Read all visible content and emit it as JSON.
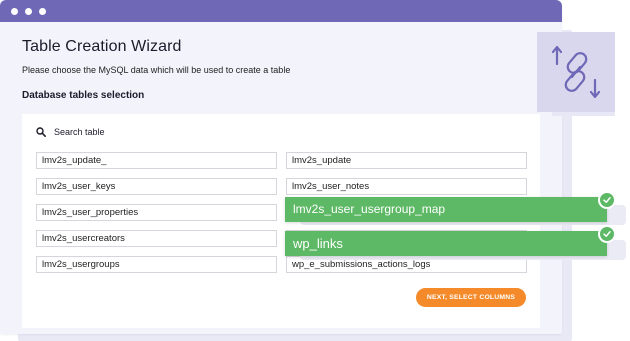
{
  "window": {
    "titlebar_color": "#6f68b6"
  },
  "wizard": {
    "title": "Table Creation Wizard",
    "description": "Please choose the MySQL data which will be used to create a table",
    "section_title": "Database tables selection",
    "search": {
      "label": "Search table",
      "icon": "search-icon"
    },
    "tables_left": [
      "lmv2s_update_",
      "lmv2s_user_keys",
      "lmv2s_user_properties",
      "lmv2s_usercreators",
      "lmv2s_usergroups"
    ],
    "tables_right": [
      "lmv2s_update",
      "lmv2s_user_notes",
      "wp_e_submissions_actions_logs"
    ],
    "next_button": "NEXT, SELECT COLUMNS"
  },
  "selected_tables": [
    {
      "label": "lmv2s_user_usergroup_map",
      "status_icon": "check-icon"
    },
    {
      "label": "wp_links",
      "status_icon": "check-icon"
    }
  ],
  "colors": {
    "accent_green": "#5db965",
    "accent_orange": "#f58a2a",
    "icon_purple": "#6f68b6"
  },
  "decor": {
    "icon": "link-transfer-icon"
  }
}
